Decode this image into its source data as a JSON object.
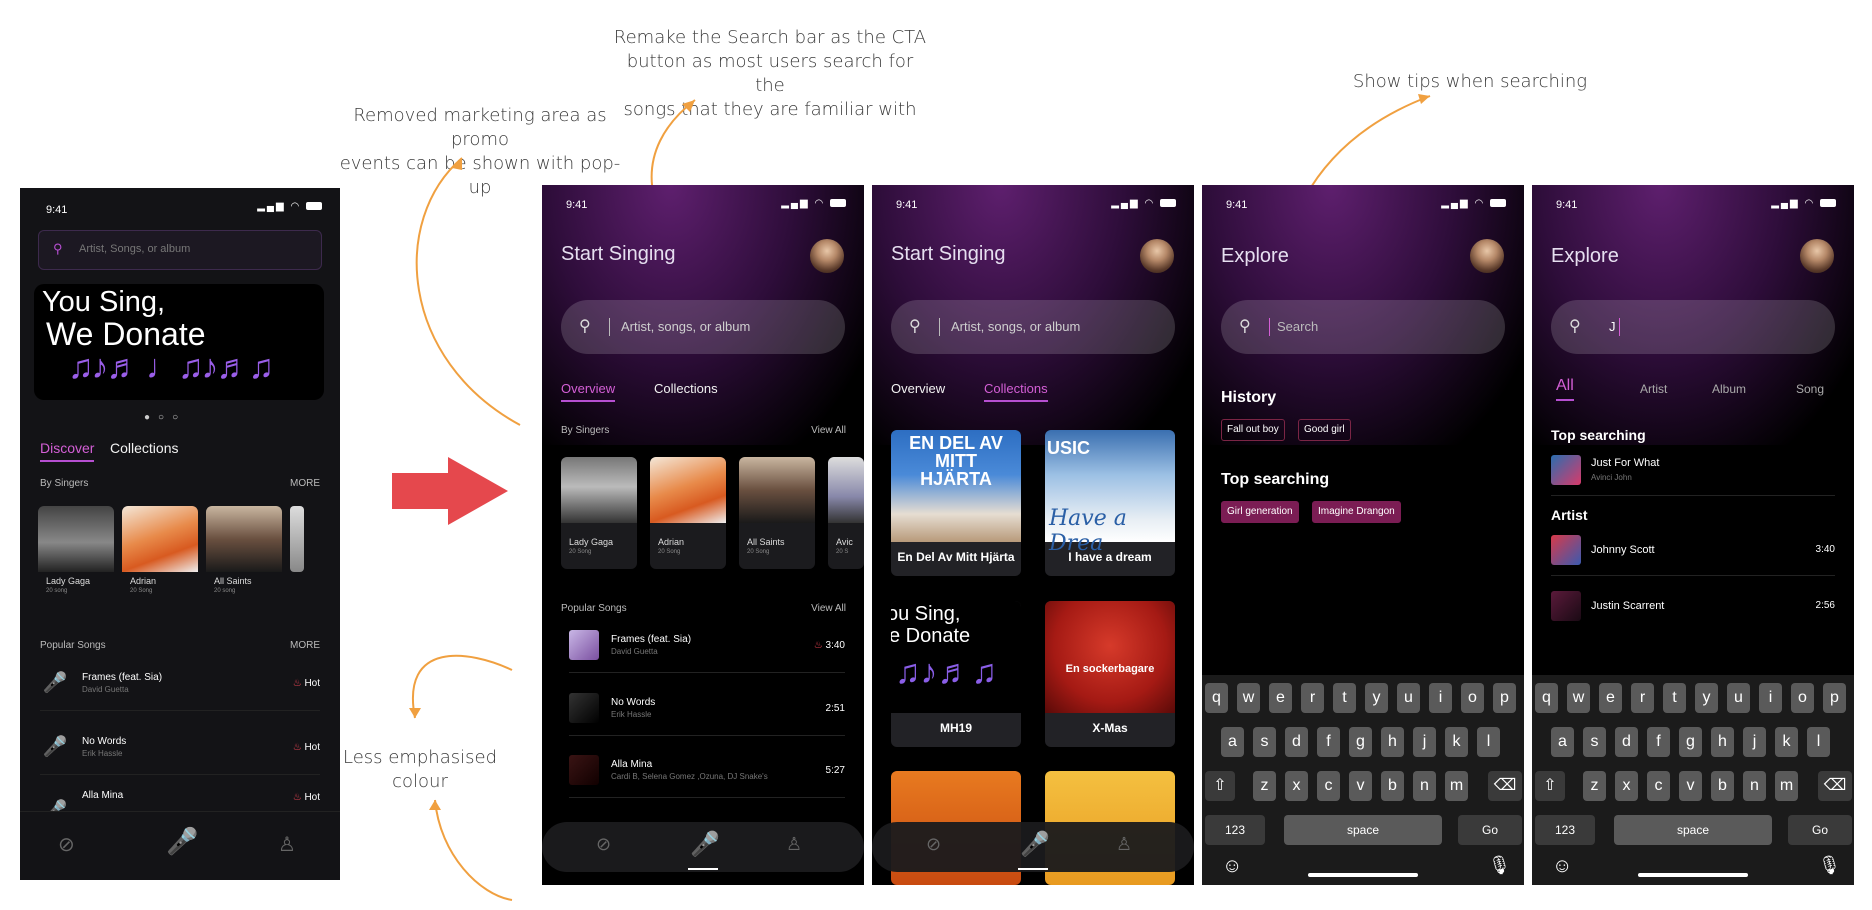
{
  "notes": {
    "search_cta": "Remake the Search bar as the CTA button as most users search for the songs that they are familiar with",
    "search_cta_lines": [
      "Remake the Search bar as the CTA",
      "button as most users search for the",
      "songs that they are familiar with"
    ],
    "marketing": [
      "Removed marketing area as promo",
      "events can be shown with pop-up"
    ],
    "tips": "Show tips when searching",
    "colour": [
      "Less emphasised",
      "colour"
    ]
  },
  "status_time": "9:41",
  "old_screen": {
    "search_placeholder": "Artist, Songs, or album",
    "banner_line1": "You Sing,",
    "banner_line2": "We Donate",
    "tabs": [
      "Discover",
      "Collections"
    ],
    "by_singers": "By Singers",
    "more": "MORE",
    "singers": [
      {
        "name": "Lady Gaga",
        "count": "20 song"
      },
      {
        "name": "Adrian",
        "count": "20 Song"
      },
      {
        "name": "All Saints",
        "count": "20 song"
      }
    ],
    "popular_songs": "Popular Songs",
    "songs": [
      {
        "title": "Frames (feat. Sia)",
        "artist": "David Guetta",
        "badge": "Hot"
      },
      {
        "title": "No Words",
        "artist": "Erik Hassle",
        "badge": "Hot"
      },
      {
        "title": "Alla Mina",
        "artist": "",
        "badge": "Hot"
      }
    ]
  },
  "screen2": {
    "title": "Start Singing",
    "search_placeholder": "Artist, songs, or album",
    "tabs": [
      "Overview",
      "Collections"
    ],
    "by_singers": "By Singers",
    "view_all": "View All",
    "singers": [
      {
        "name": "Lady Gaga",
        "count": "20 Song"
      },
      {
        "name": "Adrian",
        "count": "20 Song"
      },
      {
        "name": "All Saints",
        "count": "20 Song"
      },
      {
        "name": "Avic",
        "count": "20 S"
      }
    ],
    "popular_songs": "Popular Songs",
    "songs": [
      {
        "title": "Frames (feat. Sia)",
        "artist": "David Guetta",
        "duration": "3:40"
      },
      {
        "title": "No Words",
        "artist": "Erik Hassle",
        "duration": "2:51"
      },
      {
        "title": "Alla Mina",
        "artist": "Cardi B, Selena Gomez ,Ozuna, DJ Snake's",
        "duration": "5:27"
      }
    ]
  },
  "screen3": {
    "title": "Start Singing",
    "search_placeholder": "Artist, songs, or album",
    "tabs": [
      "Overview",
      "Collections"
    ],
    "collections": [
      "En Del Av Mitt Hjärta",
      "I have a dream",
      "MH19",
      "X-Mas"
    ],
    "art_text": {
      "c1": "EN DEL AV MITT HJÄRTA",
      "c2": "USIC",
      "c2b": "Have a Drea",
      "c3a": "ou Sing,",
      "c3b": "e Donate",
      "c4": "En sockerbagare"
    }
  },
  "screen4": {
    "title": "Explore",
    "search_value": "Search",
    "history_label": "History",
    "history": [
      "Fall out boy",
      "Good girl"
    ],
    "top_label": "Top searching",
    "top": [
      "Girl generation",
      "Imagine Drangon"
    ]
  },
  "screen5": {
    "title": "Explore",
    "search_value": "J",
    "tabs": [
      "All",
      "Artist",
      "Album",
      "Song"
    ],
    "top_label": "Top searching",
    "top_item": {
      "title": "Just For What",
      "artist": "Avinci John"
    },
    "artist_label": "Artist",
    "artists": [
      {
        "name": "Johnny Scott",
        "duration": "3:40"
      },
      {
        "name": "Justin Scarrent",
        "duration": "2:56"
      }
    ]
  },
  "keyboard": {
    "row1": [
      "q",
      "w",
      "e",
      "r",
      "t",
      "y",
      "u",
      "i",
      "o",
      "p"
    ],
    "row2": [
      "a",
      "s",
      "d",
      "f",
      "g",
      "h",
      "j",
      "k",
      "l"
    ],
    "row3": [
      "z",
      "x",
      "c",
      "v",
      "b",
      "n",
      "m"
    ],
    "num": "123",
    "space": "space",
    "go": "Go"
  },
  "colors": {
    "accent": "#d45fd6",
    "hot": "#ff4a5a",
    "arrow": "#e5484d",
    "annotation": "#f0a040"
  }
}
